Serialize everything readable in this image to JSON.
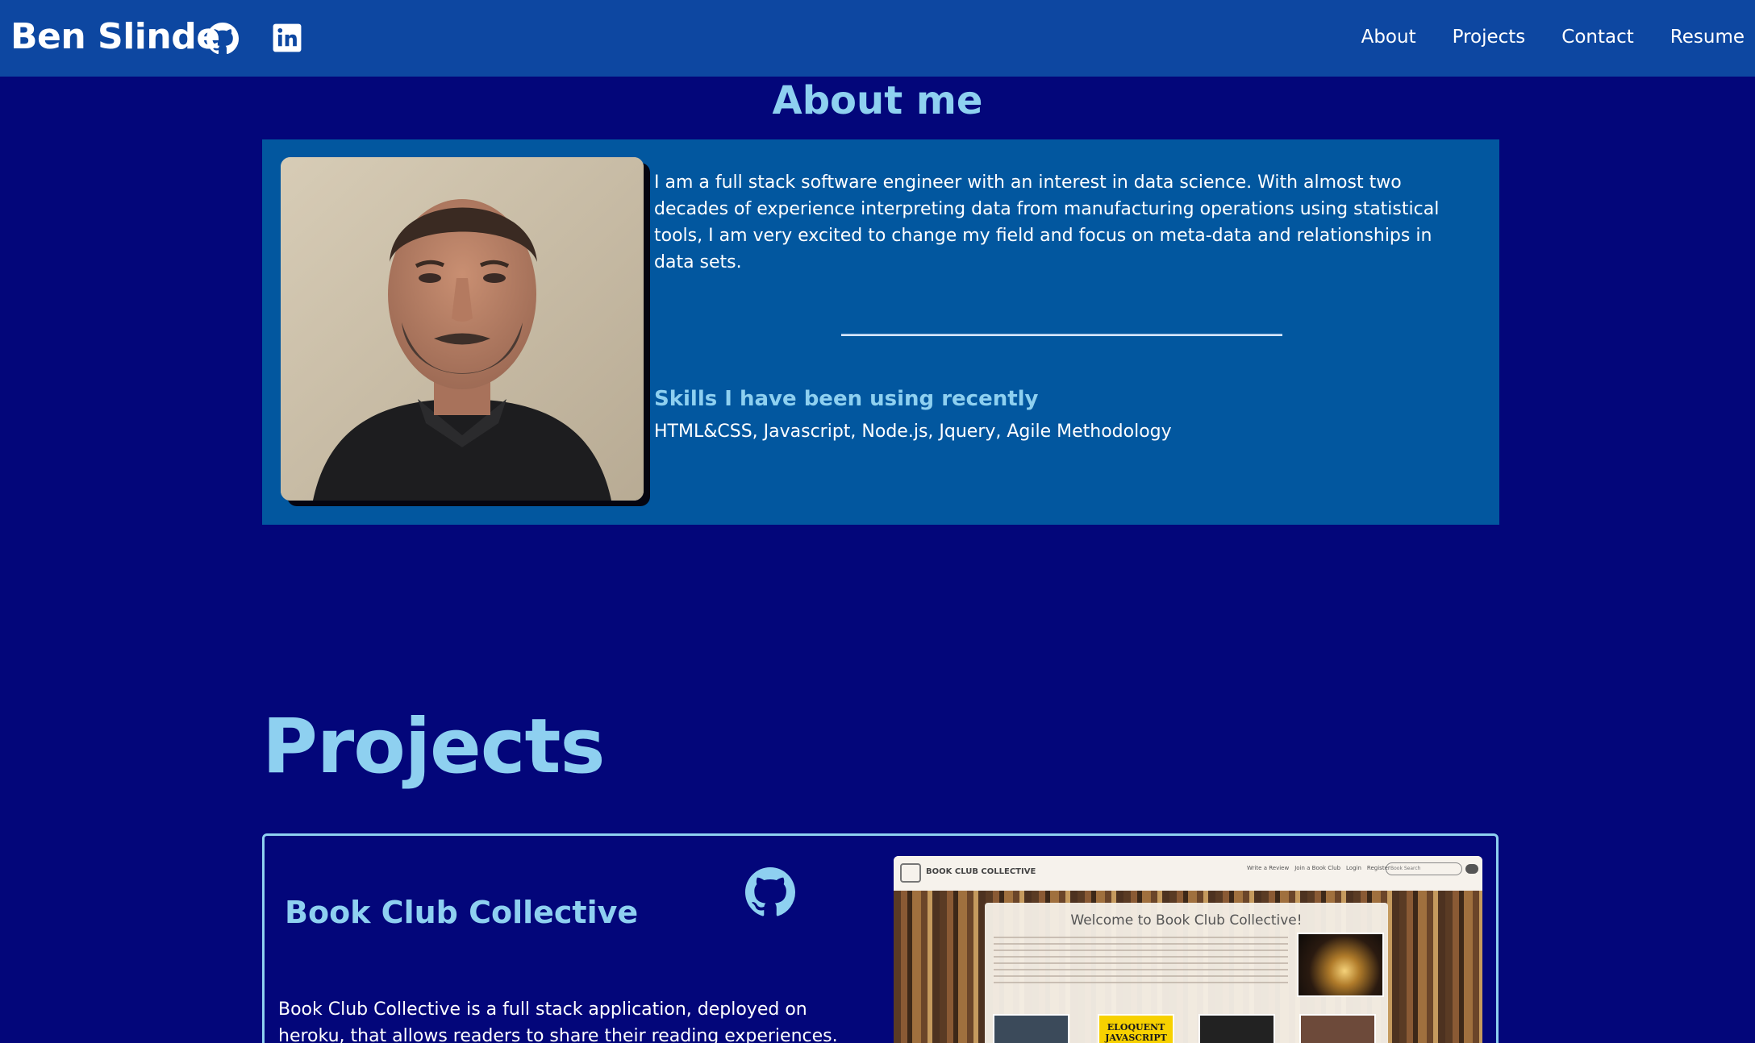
{
  "header": {
    "brand": "Ben Slinde",
    "nav": [
      "About",
      "Projects",
      "Contact",
      "Resume"
    ]
  },
  "about": {
    "title": "About me",
    "bio": "I am a full stack software engineer with an interest in data science. With almost two decades of experience interpreting data from manufacturing operations using statistical tools, I am very excited to change my field and focus on meta-data and relationships in data sets.",
    "skills_title": "Skills I have been using recently",
    "skills": "HTML&CSS, Javascript, Node.js, Jquery, Agile Methodology"
  },
  "projects": {
    "title": "Projects",
    "items": [
      {
        "name": "Book Club Collective",
        "description": "Book Club Collective is a full stack application, deployed on heroku, that allows readers to share their reading experiences. After making a profile,",
        "screenshot": {
          "brand": "BOOK CLUB COLLECTIVE",
          "nav": [
            "Write a Review",
            "Join a Book Club",
            "Login",
            "Register"
          ],
          "search_placeholder": "Book Search",
          "welcome": "Welcome to Book Club Collective!",
          "book_title": "ELOQUENT JAVASCRIPT"
        }
      }
    ]
  },
  "colors": {
    "background": "#03067a",
    "header": "#0d47a1",
    "card": "#02579f",
    "accent": "#8ed0f0"
  },
  "icons": {
    "github": "github-icon",
    "linkedin": "linkedin-icon"
  }
}
